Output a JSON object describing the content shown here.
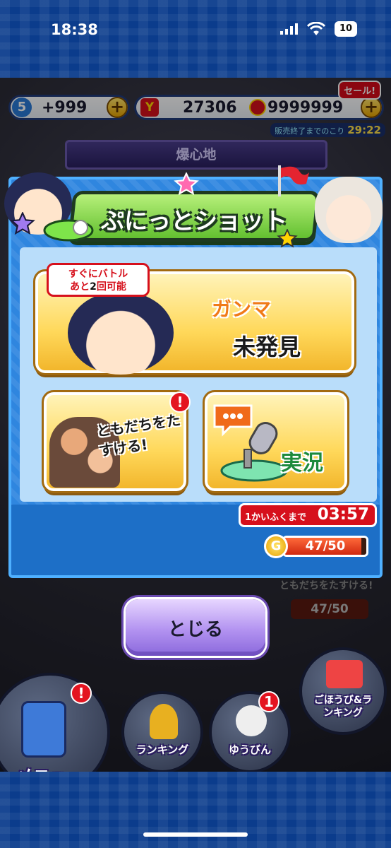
{
  "status_bar": {
    "time": "18:38",
    "battery": "10"
  },
  "hud": {
    "level": "5",
    "stamina": "+999",
    "ymoney": "27306",
    "coins": "9999999",
    "sale_badge": "セール!",
    "sale_timer_label": "販売終了までのこり",
    "sale_timer": "29:22",
    "location": "爆心地"
  },
  "dialog": {
    "title": "ぷにっとショット",
    "main_card": {
      "badge_line1": "すぐにバトル",
      "badge_line2_pre": "あと",
      "badge_count": "2",
      "badge_line2_post": "回可能",
      "name": "ガンマ",
      "status": "未発見"
    },
    "friends_card": {
      "label": "ともだちをたすける!",
      "alert": "!"
    },
    "live_card": {
      "label": "実況"
    },
    "recover_label": "1かいふくまで",
    "recover_time": "03:57",
    "gauge_text": "47/50",
    "gauge_value": 47,
    "gauge_max": 50,
    "gauge_icon": "G",
    "close_label": "とじる"
  },
  "behind": {
    "gauge_text": "47/50",
    "help_text": "ともだちをたすける!"
  },
  "nav": {
    "menu": "メニュー",
    "ranking": "ランキング",
    "mail": "ゆうびん",
    "mail_badge": "1",
    "menu_badge": "!",
    "reward": "ごほうび&ランキング"
  }
}
